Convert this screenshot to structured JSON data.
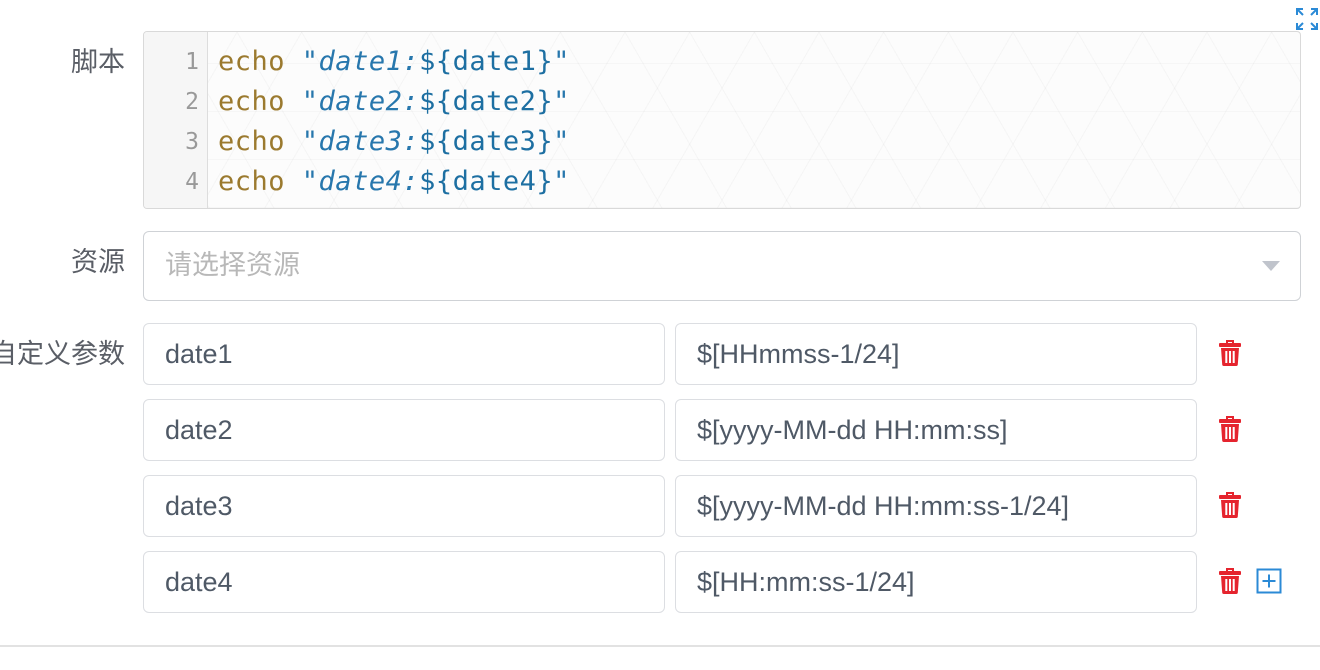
{
  "toolbar": {
    "fullscreen_icon": "expand-icon"
  },
  "script": {
    "label": "脚本",
    "lines": [
      {
        "number": "1",
        "keyword": "echo",
        "string_open": "\"date1:",
        "interpolation": "${date1}",
        "string_close": "\""
      },
      {
        "number": "2",
        "keyword": "echo",
        "string_open": "\"date2:",
        "interpolation": "${date2}",
        "string_close": "\""
      },
      {
        "number": "3",
        "keyword": "echo",
        "string_open": "\"date3:",
        "interpolation": "${date3}",
        "string_close": "\""
      },
      {
        "number": "4",
        "keyword": "echo",
        "string_open": "\"date4:",
        "interpolation": "${date4}",
        "string_close": "\""
      }
    ]
  },
  "resource": {
    "label": "资源",
    "placeholder": "请选择资源",
    "arrow_icon": "caret-down-icon"
  },
  "params": {
    "label": "自定义参数",
    "rows": [
      {
        "name": "date1",
        "value": "$[HHmmss-1/24]"
      },
      {
        "name": "date2",
        "value": "$[yyyy-MM-dd HH:mm:ss]"
      },
      {
        "name": "date3",
        "value": "$[yyyy-MM-dd HH:mm:ss-1/24]"
      },
      {
        "name": "date4",
        "value": "$[HH:mm:ss-1/24]"
      }
    ],
    "delete_icon": "trash-icon",
    "add_icon": "plus-square-icon"
  },
  "colors": {
    "keyword": "#9b7a2f",
    "string": "#2777ad",
    "interpolation": "#1d6fa2",
    "line_number": "#999999",
    "label": "#5a5e66",
    "input_text": "#4f5966",
    "placeholder": "#b8b8b8",
    "delete_icon": "#e5242e",
    "add_icon": "#2b8ad6",
    "fullscreen_icon": "#2b8ad6"
  }
}
